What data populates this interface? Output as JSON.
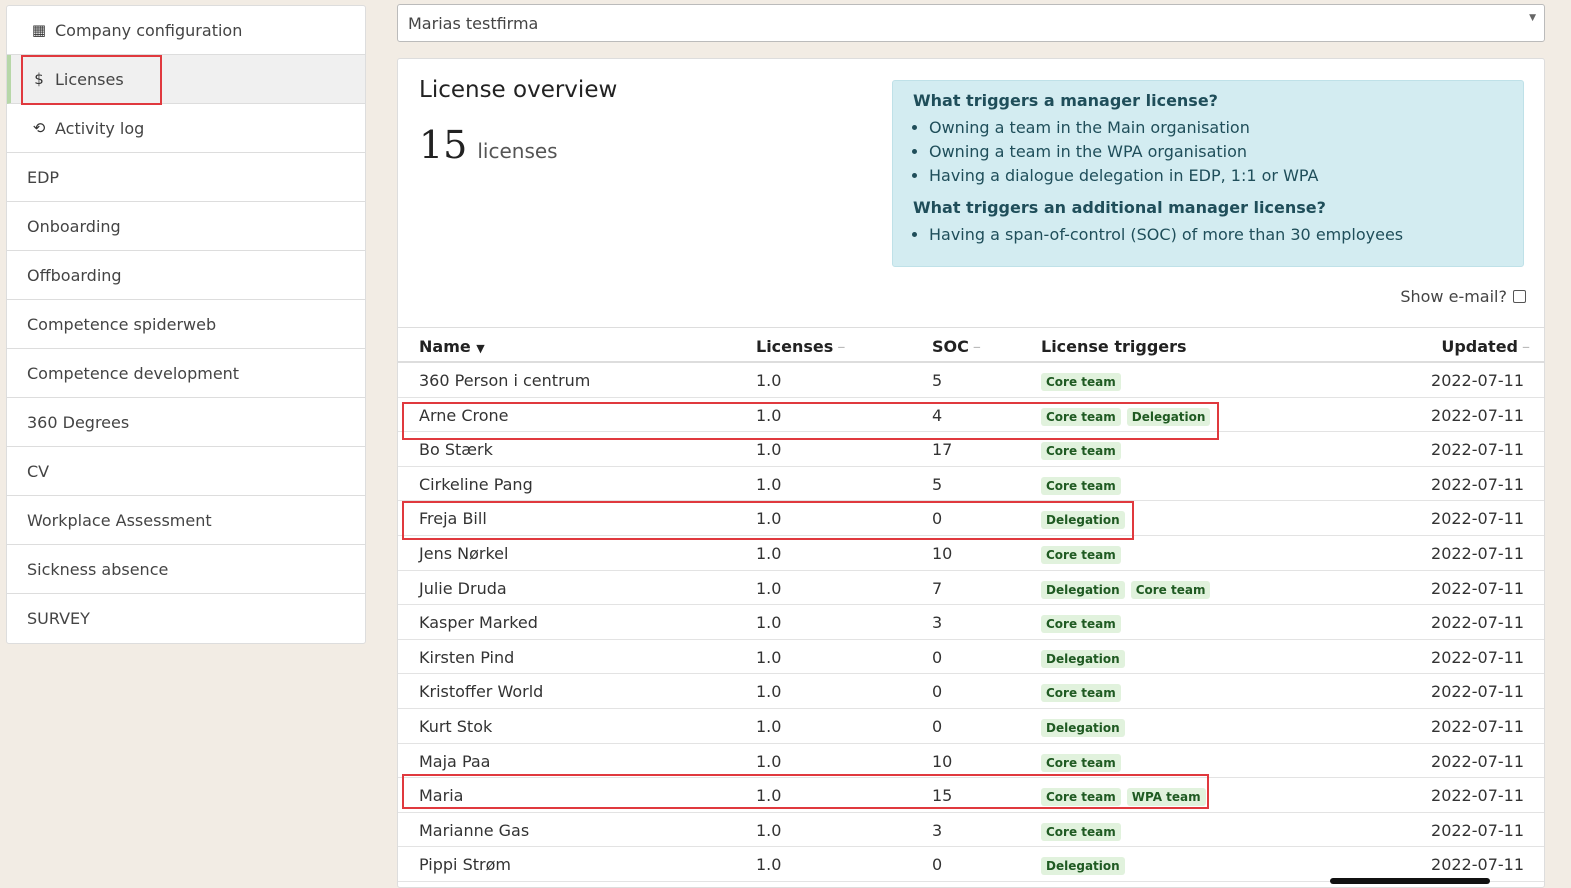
{
  "sidebar": {
    "items": [
      {
        "label": "Company configuration",
        "icon": "building-icon"
      },
      {
        "label": "Licenses",
        "icon": "dollar-icon",
        "active": true
      },
      {
        "label": "Activity log",
        "icon": "history-icon"
      },
      {
        "label": "EDP"
      },
      {
        "label": "Onboarding"
      },
      {
        "label": "Offboarding"
      },
      {
        "label": "Competence spiderweb"
      },
      {
        "label": "Competence development"
      },
      {
        "label": "360 Degrees"
      },
      {
        "label": "CV"
      },
      {
        "label": "Workplace Assessment"
      },
      {
        "label": "Sickness absence"
      },
      {
        "label": "SURVEY"
      }
    ]
  },
  "company_select": {
    "value": "Marias testfirma"
  },
  "overview": {
    "title": "License overview",
    "count": "15",
    "count_label": "licenses"
  },
  "info": {
    "manager_heading": "What triggers a manager license?",
    "manager_items": [
      "Owning a team in the Main organisation",
      "Owning a team in the WPA organisation",
      "Having a dialogue delegation in EDP, 1:1 or WPA"
    ],
    "additional_heading": "What triggers an additional manager license?",
    "additional_items": [
      "Having a span-of-control (SOC) of more than 30 employees"
    ]
  },
  "show_email_label": "Show e-mail?",
  "table": {
    "headers": {
      "name": "Name",
      "licenses": "Licenses",
      "soc": "SOC",
      "triggers": "License triggers",
      "updated": "Updated"
    },
    "rows": [
      {
        "name": "360 Person i centrum",
        "licenses": "1.0",
        "soc": "5",
        "triggers": [
          "Core team"
        ],
        "updated": "2022-07-11"
      },
      {
        "name": "Arne Crone",
        "licenses": "1.0",
        "soc": "4",
        "triggers": [
          "Core team",
          "Delegation"
        ],
        "updated": "2022-07-11"
      },
      {
        "name": "Bo Stærk",
        "licenses": "1.0",
        "soc": "17",
        "triggers": [
          "Core team"
        ],
        "updated": "2022-07-11"
      },
      {
        "name": "Cirkeline Pang",
        "licenses": "1.0",
        "soc": "5",
        "triggers": [
          "Core team"
        ],
        "updated": "2022-07-11"
      },
      {
        "name": "Freja Bill",
        "licenses": "1.0",
        "soc": "0",
        "triggers": [
          "Delegation"
        ],
        "updated": "2022-07-11"
      },
      {
        "name": "Jens Nørkel",
        "licenses": "1.0",
        "soc": "10",
        "triggers": [
          "Core team"
        ],
        "updated": "2022-07-11"
      },
      {
        "name": "Julie Druda",
        "licenses": "1.0",
        "soc": "7",
        "triggers": [
          "Delegation",
          "Core team"
        ],
        "updated": "2022-07-11"
      },
      {
        "name": "Kasper Marked",
        "licenses": "1.0",
        "soc": "3",
        "triggers": [
          "Core team"
        ],
        "updated": "2022-07-11"
      },
      {
        "name": "Kirsten Pind",
        "licenses": "1.0",
        "soc": "0",
        "triggers": [
          "Delegation"
        ],
        "updated": "2022-07-11"
      },
      {
        "name": "Kristoffer World",
        "licenses": "1.0",
        "soc": "0",
        "triggers": [
          "Core team"
        ],
        "updated": "2022-07-11"
      },
      {
        "name": "Kurt Stok",
        "licenses": "1.0",
        "soc": "0",
        "triggers": [
          "Delegation"
        ],
        "updated": "2022-07-11"
      },
      {
        "name": "Maja Paa",
        "licenses": "1.0",
        "soc": "10",
        "triggers": [
          "Core team"
        ],
        "updated": "2022-07-11"
      },
      {
        "name": "Maria",
        "licenses": "1.0",
        "soc": "15",
        "triggers": [
          "Core team",
          "WPA team"
        ],
        "updated": "2022-07-11"
      },
      {
        "name": "Marianne Gas",
        "licenses": "1.0",
        "soc": "3",
        "triggers": [
          "Core team"
        ],
        "updated": "2022-07-11"
      },
      {
        "name": "Pippi Strøm",
        "licenses": "1.0",
        "soc": "0",
        "triggers": [
          "Delegation"
        ],
        "updated": "2022-07-11"
      }
    ]
  },
  "colors": {
    "highlight": "#e0393e",
    "tag_bg": "#e1f2dd",
    "info_bg": "#d3ecf1"
  }
}
